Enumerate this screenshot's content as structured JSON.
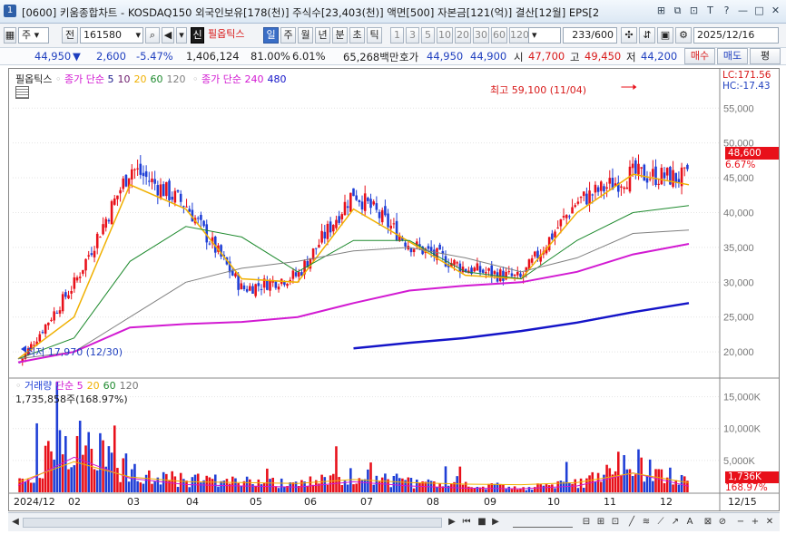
{
  "window": {
    "app_number": "1",
    "title": "[0600] 키움종합차트 - KOSDAQ150 외국인보유[178(천)] 주식수[23,403(천)] 액면[500] 자본금[121(억)] 결산[12월] EPS[2",
    "controls": [
      "⊞",
      "⧉",
      "⊡",
      "T",
      "?",
      "—",
      "□",
      "✕"
    ]
  },
  "toolbar": {
    "type_label": "주",
    "prefix_label": "전",
    "code_value": "161580",
    "search_icon": "🔍",
    "sound_icon": "◀",
    "credit_label": "신",
    "product_name": "필옵틱스",
    "period_tabs": [
      "일",
      "주",
      "월",
      "년",
      "분",
      "초",
      "틱"
    ],
    "active_period": "일",
    "interval_buttons": [
      "1",
      "3",
      "5",
      "10",
      "20",
      "30",
      "60",
      "120"
    ],
    "page_value": "233/600",
    "date_value": "2025/12/16"
  },
  "quote": {
    "price": "44,950",
    "direction": "▼",
    "change": "2,600",
    "change_pct": "-5.47%",
    "volume": "1,406,124",
    "vol_ratio": "81.00%",
    "turnover": "6.01%",
    "amount": "65,268백만",
    "ask_label": "호가",
    "ask_value": "44,950",
    "bid_value": "44,900",
    "open_label": "시",
    "open_value": "47,700",
    "high_label": "고",
    "high_value": "49,450",
    "low_label": "저",
    "low_value": "44,200",
    "buy_button": "매수",
    "sell_button": "매도",
    "eval_button": "평"
  },
  "price_pane": {
    "stock_label": "필옵틱스",
    "ma_label": "종가 단순",
    "ma_periods": [
      "5",
      "10",
      "20",
      "60",
      "120"
    ],
    "ma2_label": "종가 단순",
    "ma2_periods": [
      "240",
      "480"
    ],
    "lc_label": "LC:171.56",
    "hc_label": "HC:-17.43",
    "high_annotation": "최고 59,100 (11/04)",
    "low_annotation": "최저 17,970 (12/30)",
    "last_price_tag": "48,600",
    "last_pct_tag": "6.67%"
  },
  "volume_pane": {
    "label": "거래량",
    "ma_label": "단순",
    "ma_periods": [
      "5",
      "20",
      "60",
      "120"
    ],
    "current_readout": "1,735,858주(168.97%)",
    "last_vol_tag": "1,736K",
    "last_vol_pct_tag": "168.97%"
  },
  "x_axis": {
    "labels": [
      "2024/12",
      "02",
      "03",
      "04",
      "05",
      "06",
      "07",
      "08",
      "09",
      "10",
      "11",
      "12"
    ],
    "right_label": "12/15"
  },
  "colors": {
    "up": "#e8101a",
    "down": "#1f3fd6",
    "ma5": "#1a1a8c",
    "ma10": "#6b1a6b",
    "ma20": "#f0b000",
    "ma60": "#1e8a2e",
    "ma120": "#808080",
    "ma240": "#d21ad2",
    "ma480": "#1414c8"
  },
  "chart_data": [
    {
      "type": "line",
      "title": "필옵틱스",
      "y_ticks": [
        20000,
        25000,
        30000,
        35000,
        40000,
        45000,
        50000,
        55000
      ],
      "y_tick_labels": [
        "20,000",
        "25,000",
        "30,000",
        "35,000",
        "40,000",
        "45,000",
        "50,000",
        "55,000"
      ],
      "ylim": [
        16500,
        60500
      ],
      "x": [
        "2024-12",
        "2025-01",
        "2025-02",
        "2025-03",
        "2025-04",
        "2025-05",
        "2025-06",
        "2025-07",
        "2025-08",
        "2025-09",
        "2025-10",
        "2025-11",
        "2025-12"
      ],
      "series": [
        {
          "name": "종가",
          "values": [
            18500,
            30000,
            46500,
            41000,
            29000,
            31000,
            43000,
            35500,
            32000,
            30500,
            41500,
            45500,
            44950
          ]
        },
        {
          "name": "20",
          "values": [
            19000,
            25000,
            44000,
            40500,
            30500,
            30000,
            40500,
            35800,
            31000,
            30500,
            40000,
            45500,
            44000
          ]
        },
        {
          "name": "60",
          "values": [
            19000,
            22000,
            33000,
            38000,
            36500,
            31500,
            36000,
            36000,
            31500,
            30500,
            36000,
            40000,
            41000
          ]
        },
        {
          "name": "120",
          "values": [
            19000,
            20000,
            25000,
            30000,
            32000,
            33000,
            34500,
            35000,
            33500,
            31500,
            33500,
            37000,
            37500
          ]
        },
        {
          "name": "240",
          "values": [
            18500,
            20000,
            23500,
            24000,
            24300,
            25000,
            27000,
            28800,
            29500,
            30000,
            31500,
            34000,
            35500
          ]
        },
        {
          "name": "480",
          "values": [
            null,
            null,
            null,
            null,
            null,
            null,
            20500,
            21300,
            22000,
            23000,
            24200,
            25700,
            27000
          ]
        }
      ]
    },
    {
      "type": "bar",
      "title": "거래량",
      "y_ticks": [
        5000,
        10000,
        15000
      ],
      "y_tick_labels": [
        "5,000K",
        "10,000K",
        "15,000K"
      ],
      "ylim": [
        0,
        17500
      ],
      "categories": [
        "2024-12",
        "2025-01",
        "2025-02",
        "2025-03",
        "2025-04",
        "2025-05",
        "2025-06",
        "2025-07",
        "2025-08",
        "2025-09",
        "2025-10",
        "2025-11",
        "2025-12"
      ],
      "values": [
        2000,
        10000,
        4000,
        2200,
        1800,
        1500,
        3000,
        1800,
        1200,
        1000,
        1800,
        5500,
        1736
      ]
    }
  ]
}
